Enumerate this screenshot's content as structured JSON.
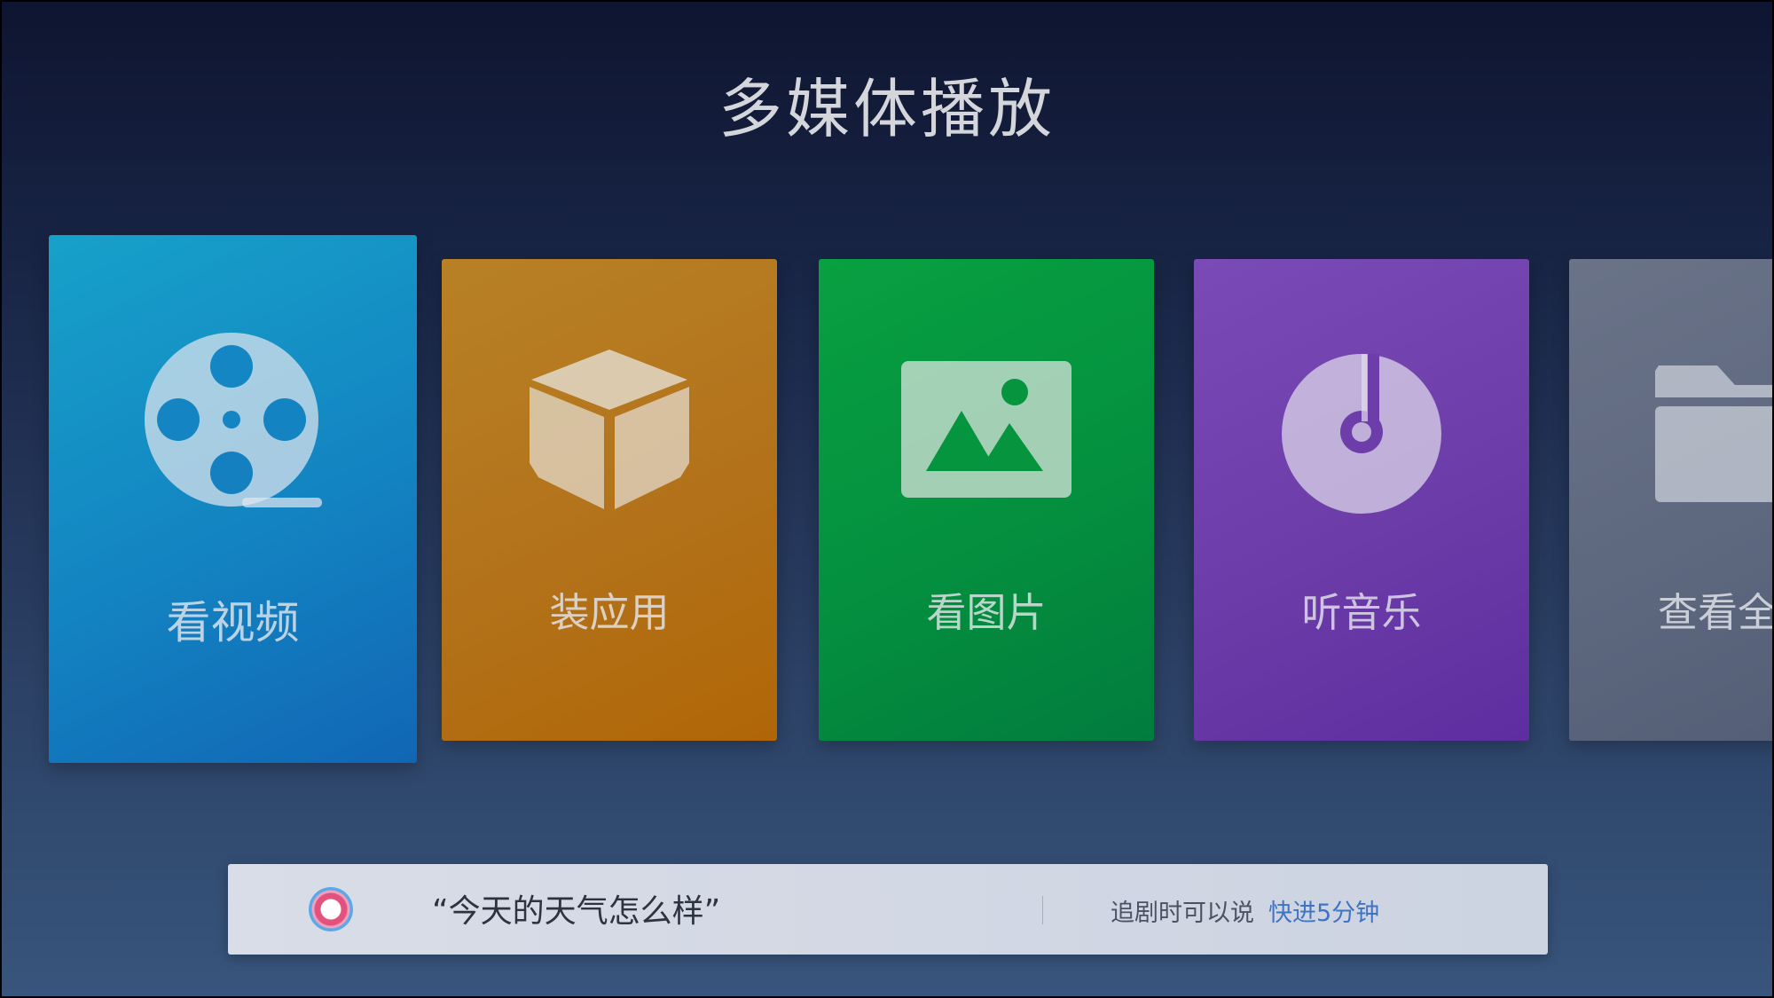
{
  "page": {
    "title": "多媒体播放"
  },
  "tiles": [
    {
      "id": "video",
      "label": "看视频",
      "icon": "film-reel-icon",
      "color": "#1384c2"
    },
    {
      "id": "apps",
      "label": "装应用",
      "icon": "package-box-icon",
      "color": "#b3721a"
    },
    {
      "id": "photos",
      "label": "看图片",
      "icon": "image-icon",
      "color": "#04903f"
    },
    {
      "id": "music",
      "label": "听音乐",
      "icon": "music-disc-icon",
      "color": "#6c3ca8"
    },
    {
      "id": "files",
      "label": "查看全",
      "icon": "folder-icon",
      "color": "#5d677e"
    }
  ],
  "voice_bar": {
    "icon": "voice-assistant-icon",
    "query": "“今天的天气怎么样”",
    "hint_prefix": "追剧时可以说",
    "hint_action": "快进5分钟",
    "hint_action_color": "#3f74c4"
  }
}
